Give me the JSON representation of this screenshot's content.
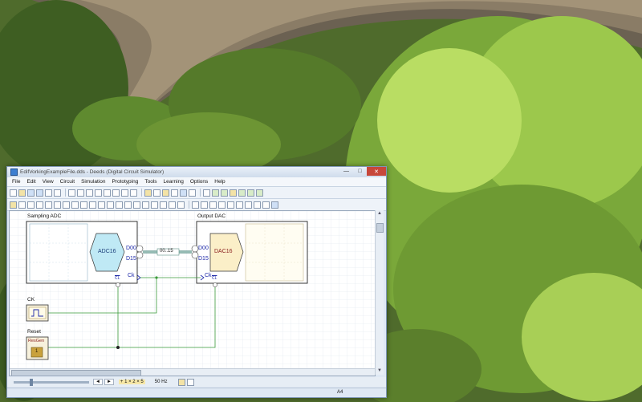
{
  "window": {
    "title": "EdifVorkingExampleFile.dds - Deeds (Digital Circuit Simulator)",
    "controls": {
      "minimize": "—",
      "maximize": "□",
      "close": "✕"
    }
  },
  "menu": [
    "File",
    "Edit",
    "View",
    "Circuit",
    "Simulation",
    "Prototyping",
    "Tools",
    "Learning",
    "Options",
    "Help"
  ],
  "circuit": {
    "sampling_title": "Sampling ADC",
    "adc_label": "ADC16",
    "adc_pin_d00": "D00",
    "adc_pin_d15": "D15",
    "adc_pin_ck": "Ck",
    "adc_pin_cl": "CL",
    "bus_label": "00..15",
    "output_title": "Output DAC",
    "dac_label": "DAC16",
    "dac_pin_d00": "D00",
    "dac_pin_d15": "D15",
    "dac_pin_ck": "Ck",
    "dac_pin_cl": "CL",
    "ck_title": "CK",
    "reset_title": "Reset",
    "resgen_label": "ResGen",
    "resgen_value": "1"
  },
  "bottombar": {
    "step_back": "◄",
    "step_fwd": "►",
    "zoom_text": "+ 1 × 2 × 5",
    "freq": "50 Hz"
  },
  "status": {
    "paper": "A4"
  },
  "colors": {
    "wire_green": "#3a9a3a",
    "bus_teal": "#5b8f86",
    "adc_fill": "#bfe9f5",
    "dac_fill": "#fbefc8",
    "pin_blue": "#1c27a8"
  }
}
